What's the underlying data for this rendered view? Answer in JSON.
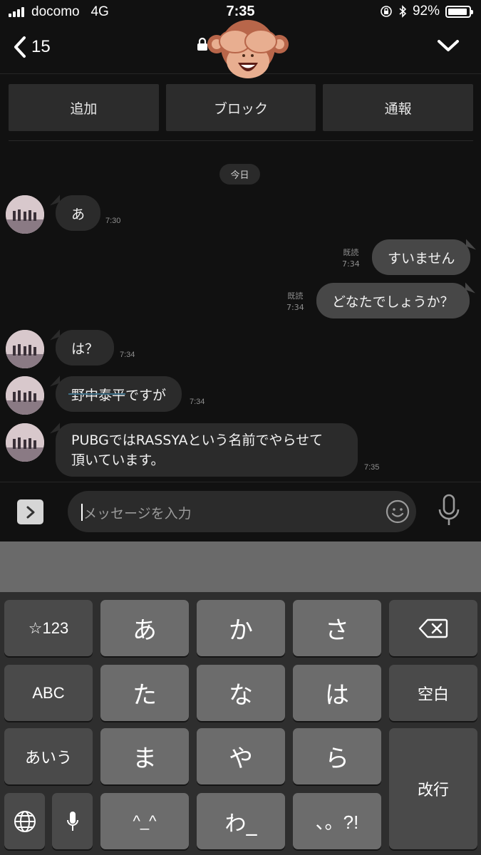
{
  "status_bar": {
    "carrier": "docomo",
    "network": "4G",
    "time": "7:35",
    "battery": "92%",
    "battery_level": 0.92
  },
  "header": {
    "back_count": "15",
    "icons": [
      "chevron-left-icon",
      "lock-icon",
      "see-no-evil-monkey-icon",
      "chevron-down-icon"
    ]
  },
  "actions": {
    "add": "追加",
    "block": "ブロック",
    "report": "通報"
  },
  "chat": {
    "date_label": "今日",
    "messages": [
      {
        "direction": "in",
        "text": "あ",
        "time": "7:30"
      },
      {
        "direction": "out",
        "text": "すいません",
        "read": "既読",
        "time": "7:34"
      },
      {
        "direction": "out",
        "text": "どなたでしょうか？",
        "read": "既読",
        "time": "7:34"
      },
      {
        "direction": "in",
        "text": "は？",
        "time": "7:34"
      },
      {
        "direction": "in",
        "text": "野中泰平ですが",
        "time": "7:34"
      },
      {
        "direction": "in",
        "text": "PUBGではRASSYAという名前でやらせて頂いています。",
        "lines": [
          "PUBGではRASSYAという名前でやらせて",
          "頂いています。"
        ],
        "time": "7:35"
      }
    ]
  },
  "input": {
    "placeholder": "メッセージを入力"
  },
  "keyboard": {
    "row1": [
      "☆123",
      "あ",
      "か",
      "さ"
    ],
    "row2": [
      "ABC",
      "た",
      "な",
      "は",
      "空白"
    ],
    "row3": [
      "あいう",
      "ま",
      "や",
      "ら",
      "改行"
    ],
    "row4": [
      "^_^",
      "わ_",
      "、。?!"
    ]
  },
  "colors": {
    "background": "#111111",
    "bubble_in": "#2b2b2b",
    "bubble_out": "#474747",
    "keyboard": "#2e2e2e"
  }
}
